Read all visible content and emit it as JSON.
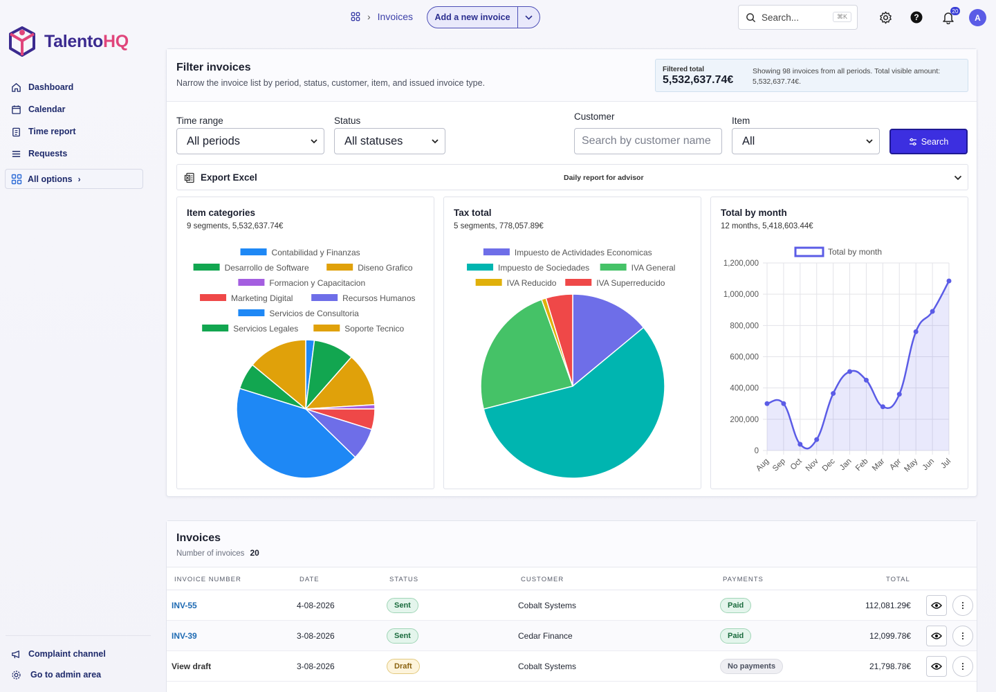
{
  "brand": {
    "name_a": "Talento",
    "name_b": "HQ"
  },
  "nav": {
    "items": [
      {
        "label": "Dashboard",
        "icon": "home-icon"
      },
      {
        "label": "Calendar",
        "icon": "calendar-icon"
      },
      {
        "label": "Time report",
        "icon": "clipboard-icon"
      },
      {
        "label": "Requests",
        "icon": "list-icon"
      }
    ],
    "all_options": "All options",
    "bottom": [
      {
        "label": "Complaint channel",
        "icon": "megaphone-icon"
      },
      {
        "label": "Go to admin area",
        "icon": "gear-icon"
      }
    ]
  },
  "topbar": {
    "breadcrumb": "Invoices",
    "add_button": "Add a new invoice",
    "search_placeholder": "Search...",
    "search_shortcut": "⌘K",
    "notifications_count": "20",
    "avatar_initial": "A"
  },
  "filter": {
    "title": "Filter invoices",
    "subtitle": "Narrow the invoice list by period, status, customer, item, and issued invoice type.",
    "total_label": "Filtered total",
    "total_value": "5,532,637.74€",
    "total_note": "Showing 98 invoices from all periods. Total visible amount: 5,532,637.74€.",
    "time_range_label": "Time range",
    "time_range_value": "All periods",
    "status_label": "Status",
    "status_value": "All statuses",
    "customer_label": "Customer",
    "customer_placeholder": "Search by customer name",
    "item_label": "Item",
    "item_value": "All",
    "search_button": "Search",
    "export_label": "Export Excel",
    "export_mid": "Daily report for advisor"
  },
  "charts": {
    "categories": {
      "title": "Item categories",
      "subtitle": "9 segments, 5,532,637.74€"
    },
    "tax": {
      "title": "Tax total",
      "subtitle": "5 segments, 778,057.89€"
    },
    "month": {
      "title": "Total by month",
      "subtitle": "12 months, 5,418,603.44€"
    }
  },
  "chart_data": [
    {
      "type": "pie",
      "title": "Item categories",
      "labels": [
        "Contabilidad y Finanzas",
        "Desarrollo de Software",
        "Diseno Grafico",
        "Formacion y Capacitacion",
        "Marketing Digital",
        "Recursos Humanos",
        "Servicios de Consultoria",
        "Servicios Legales",
        "Soporte Tecnico"
      ],
      "values": [
        2.0,
        9.5,
        12.5,
        1.0,
        4.8,
        7.5,
        42.5,
        6.2,
        14.0
      ],
      "colors": [
        "#1e88f5",
        "#12a650",
        "#e0a10a",
        "#a45ee0",
        "#ef4848",
        "#6e6ee8",
        "#1e88f5",
        "#12a650",
        "#e0a10a"
      ],
      "legend": "top"
    },
    {
      "type": "pie",
      "title": "Tax total",
      "labels": [
        "Impuesto de Actividades Economicas",
        "Impuesto de Sociedades",
        "IVA General",
        "IVA Reducido",
        "IVA Superreducido"
      ],
      "values": [
        14.0,
        57.0,
        23.5,
        0.8,
        4.7
      ],
      "colors": [
        "#6e6ee8",
        "#00b5b0",
        "#45c267",
        "#e0b00a",
        "#ef4848"
      ],
      "legend": "top"
    },
    {
      "type": "area",
      "title": "Total by month",
      "series": [
        {
          "name": "Total by month",
          "values": [
            300000,
            300000,
            40000,
            70000,
            365000,
            505000,
            450000,
            280000,
            360000,
            760000,
            890000,
            1085000
          ]
        }
      ],
      "categories": [
        "Aug",
        "Sep",
        "Oct",
        "Nov",
        "Dec",
        "Jan",
        "Feb",
        "Mar",
        "Apr",
        "May",
        "Jun",
        "Jul"
      ],
      "ylim": [
        0,
        1200000
      ],
      "yticks": [
        "0",
        "200,000",
        "400,000",
        "600,000",
        "800,000",
        "1,000,000",
        "1,200,000"
      ],
      "grid": true,
      "legend": "top",
      "color": "#5b5ce6"
    }
  ],
  "invoices": {
    "title": "Invoices",
    "count_label": "Number of invoices",
    "count": "20",
    "headers": [
      "Invoice number",
      "Date",
      "Status",
      "Customer",
      "Payments",
      "Total"
    ],
    "rows": [
      {
        "number": "INV-55",
        "date": "4-08-2026",
        "status": "Sent",
        "customer": "Cobalt Systems",
        "payment": "Paid",
        "total": "112,081.29€"
      },
      {
        "number": "INV-39",
        "date": "3-08-2026",
        "status": "Sent",
        "customer": "Cedar Finance",
        "payment": "Paid",
        "total": "12,099.78€"
      },
      {
        "number": "View draft",
        "date": "3-08-2026",
        "status": "Draft",
        "customer": "Cobalt Systems",
        "payment": "No payments",
        "total": "21,798.78€"
      }
    ]
  }
}
